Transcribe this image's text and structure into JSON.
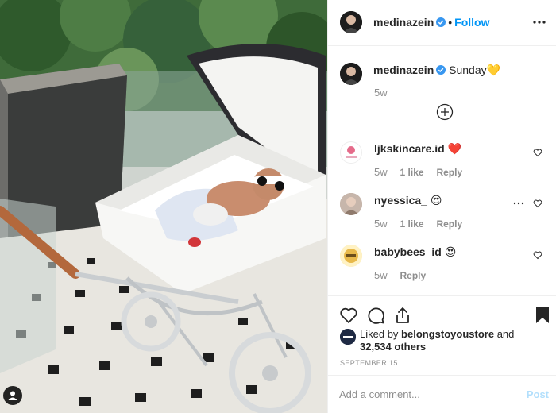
{
  "post": {
    "author": "medinazein",
    "follow_label": "Follow",
    "separator": "•",
    "caption": {
      "username": "medinazein",
      "text": "Sunday💛",
      "time": "5w"
    },
    "comments": [
      {
        "username": "ljkskincare.id",
        "text": "❤️",
        "time": "5w",
        "likes": "1 like",
        "reply": "Reply"
      },
      {
        "username": "nyessica_",
        "text": "😍",
        "time": "5w",
        "likes": "1 like",
        "reply": "Reply"
      },
      {
        "username": "babybees_id",
        "text": "😍",
        "time": "5w",
        "reply": "Reply"
      }
    ],
    "liked_by": {
      "prefix": "Liked by",
      "user": "belongstoyoustore",
      "and": "and",
      "others": "32,534 others"
    },
    "date": "SEPTEMBER 15",
    "comment_box": {
      "placeholder": "Add a comment...",
      "post_label": "Post"
    }
  },
  "colors": {
    "link_blue": "#0095f6",
    "verified_blue": "#3897f0",
    "post_disabled": "#b2dffc",
    "muted": "#8e8e8e",
    "heart_red": "#ed4956"
  },
  "icons": {
    "more": "more-horizontal-icon",
    "add_comments": "plus-circle-icon",
    "like": "heart-outline-icon",
    "comment": "comment-bubble-icon",
    "share": "share-icon",
    "save": "bookmark-filled-icon",
    "user_tag": "user-tag-icon"
  }
}
